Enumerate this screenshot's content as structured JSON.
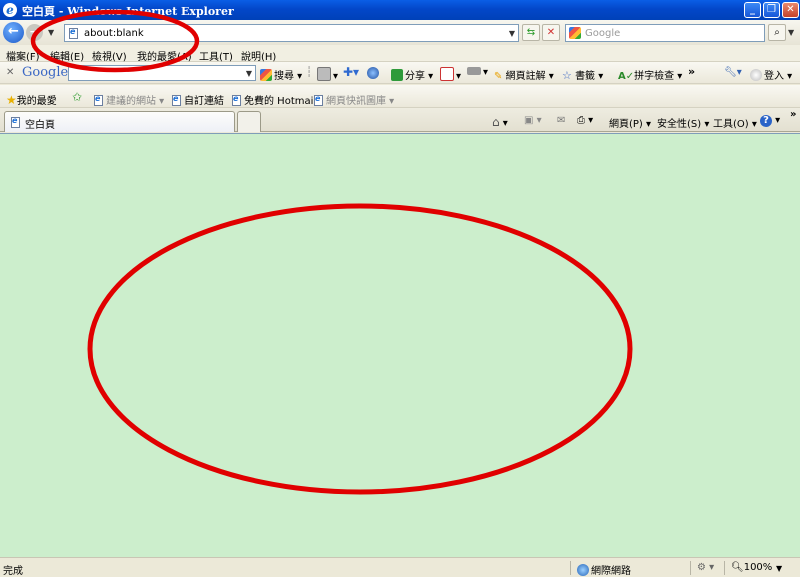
{
  "window": {
    "title": "空白頁 - Windows Internet Explorer",
    "buttons": [
      "_",
      "❐",
      "✕"
    ]
  },
  "address_bar": {
    "url": "about:blank",
    "search_placeholder": "Google"
  },
  "menu": {
    "items": [
      "檔案(F)",
      "編輯(E)",
      "檢視(V)",
      "我的最愛(A)",
      "工具(T)",
      "說明(H)"
    ]
  },
  "google_toolbar": {
    "logo": "Google",
    "search_label": "搜尋",
    "share_label": "分享",
    "annotate_label": "網頁註解",
    "bookmarks_label": "書籤",
    "spellcheck_label": "拼字檢查",
    "more_label": "»",
    "signin_label": "登入"
  },
  "favorites_bar": {
    "favorites_label": "我的最愛",
    "items": [
      "建議的網站",
      "自訂連結",
      "免費的 Hotmail",
      "網頁快訊圖庫"
    ]
  },
  "tabs": {
    "active_tab": "空白頁",
    "close_more": "»"
  },
  "command_bar": {
    "page_label": "網頁(P)",
    "safety_label": "安全性(S)",
    "tools_label": "工具(O)",
    "help_label": "?"
  },
  "status_bar": {
    "status_text": "完成",
    "zone_text": "網際網路",
    "zoom_text": "100%"
  },
  "colors": {
    "content_bg": "#cceecc",
    "annotation": "#e00000",
    "titlebar": "#0a5ee6"
  }
}
